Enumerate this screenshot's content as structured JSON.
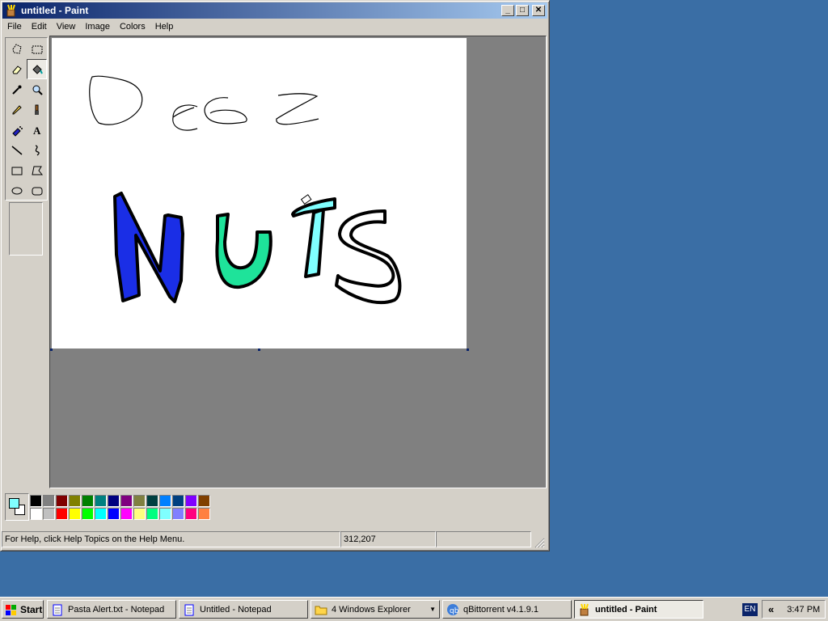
{
  "window": {
    "title": "untitled - Paint",
    "minimize": "_",
    "maximize": "□",
    "close": "✕"
  },
  "menu": [
    "File",
    "Edit",
    "View",
    "Image",
    "Colors",
    "Help"
  ],
  "tools": [
    {
      "name": "free-form-select-icon",
      "pressed": false
    },
    {
      "name": "select-icon",
      "pressed": false
    },
    {
      "name": "eraser-icon",
      "pressed": false
    },
    {
      "name": "fill-icon",
      "pressed": true
    },
    {
      "name": "pick-color-icon",
      "pressed": false
    },
    {
      "name": "magnifier-icon",
      "pressed": false
    },
    {
      "name": "pencil-icon",
      "pressed": false
    },
    {
      "name": "brush-icon",
      "pressed": false
    },
    {
      "name": "airbrush-icon",
      "pressed": false
    },
    {
      "name": "text-icon",
      "pressed": false
    },
    {
      "name": "line-icon",
      "pressed": false
    },
    {
      "name": "curve-icon",
      "pressed": false
    },
    {
      "name": "rectangle-icon",
      "pressed": false
    },
    {
      "name": "polygon-icon",
      "pressed": false
    },
    {
      "name": "ellipse-icon",
      "pressed": false
    },
    {
      "name": "rounded-rectangle-icon",
      "pressed": false
    }
  ],
  "text_tool_glyph": "A",
  "current_colors": {
    "foreground": "#80ffff",
    "background": "#ffffff"
  },
  "palette": [
    [
      "#000000",
      "#808080",
      "#800000",
      "#808000",
      "#008000",
      "#008080",
      "#000080",
      "#800080",
      "#808040",
      "#004040",
      "#0080ff",
      "#004080",
      "#8000ff",
      "#804000"
    ],
    [
      "#ffffff",
      "#c0c0c0",
      "#ff0000",
      "#ffff00",
      "#00ff00",
      "#00ffff",
      "#0000ff",
      "#ff00ff",
      "#ffff80",
      "#00ff80",
      "#80ffff",
      "#8080ff",
      "#ff0080",
      "#ff8040"
    ]
  ],
  "drawing": {
    "colors": {
      "n_fill": "#1a2ee6",
      "u_fill": "#1ee39a",
      "t_fill": "#80ffff",
      "stroke": "#000000"
    }
  },
  "status": {
    "help_text": "For Help, click Help Topics on the Help Menu.",
    "coords": "312,207",
    "size": ""
  },
  "taskbar": {
    "start_label": "Start",
    "tasks": [
      {
        "label": "Pasta Alert.txt - Notepad",
        "icon": "notepad-icon",
        "active": false
      },
      {
        "label": "Untitled - Notepad",
        "icon": "notepad-icon",
        "active": false
      },
      {
        "label": "4 Windows Explorer",
        "icon": "folder-icon",
        "active": false
      },
      {
        "label": "qBittorrent v4.1.9.1",
        "icon": "qbittorrent-icon",
        "active": false
      },
      {
        "label": "untitled - Paint",
        "icon": "paint-icon",
        "active": true
      }
    ],
    "language": "EN",
    "tray_arrow": "«",
    "clock": "3:47 PM"
  }
}
